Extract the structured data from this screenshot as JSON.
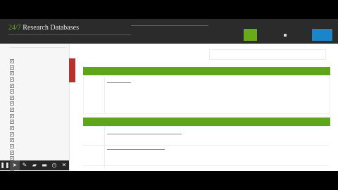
{
  "header": {
    "brand_number": "24/7",
    "brand_name": "Research Databases"
  },
  "sidebar": {
    "items": [
      {
        "checked": true
      },
      {
        "checked": true
      },
      {
        "checked": true
      },
      {
        "checked": true
      },
      {
        "checked": true
      },
      {
        "checked": true
      },
      {
        "checked": true
      },
      {
        "checked": true
      },
      {
        "checked": true
      },
      {
        "checked": true
      },
      {
        "checked": true
      },
      {
        "checked": true
      },
      {
        "checked": true
      },
      {
        "checked": true
      },
      {
        "checked": true
      },
      {
        "checked": true
      },
      {
        "checked": true
      },
      {
        "checked": true
      },
      {
        "checked": true
      },
      {
        "checked": true
      },
      {
        "checked": true
      },
      {
        "checked": true
      }
    ]
  },
  "toolbar": {
    "tools": [
      {
        "icon": "pause-icon",
        "glyph": "❚❚"
      },
      {
        "icon": "pointer-icon",
        "glyph": "➤"
      },
      {
        "icon": "pen-icon",
        "glyph": "✎"
      },
      {
        "icon": "highlighter-icon",
        "glyph": "▰"
      },
      {
        "icon": "rectangle-icon",
        "glyph": "▬"
      },
      {
        "icon": "timer-icon",
        "glyph": "◷"
      },
      {
        "icon": "close-icon",
        "glyph": "✕"
      }
    ]
  },
  "colors": {
    "accent_green": "#5fa51b",
    "brand_green": "#6aa52e",
    "button_blue": "#1a85c8",
    "marker_red": "#b8312f",
    "header_bg": "#2b2b2b"
  }
}
